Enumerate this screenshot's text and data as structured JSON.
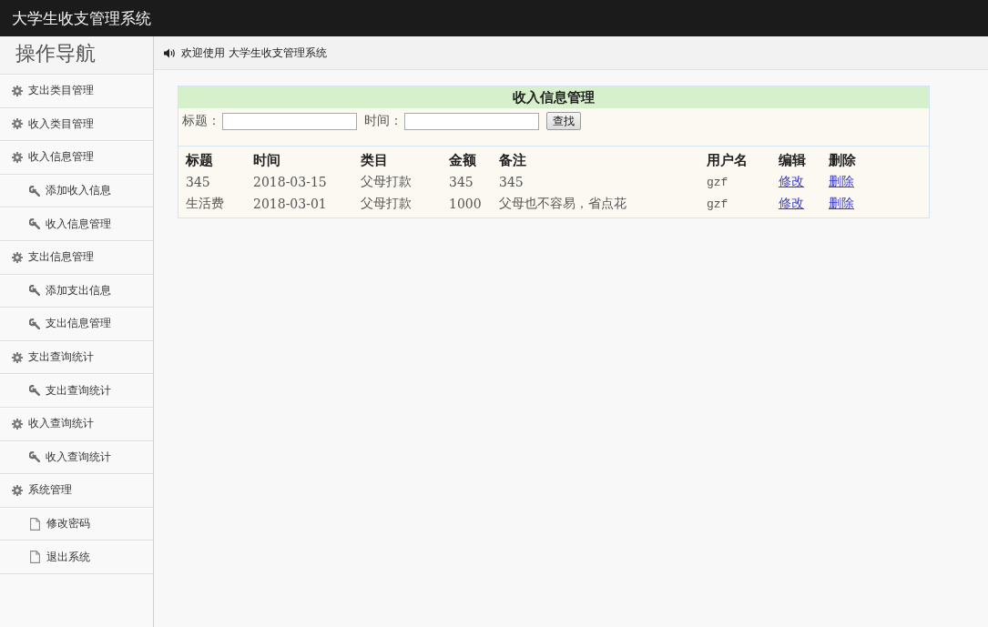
{
  "header": {
    "title": "大学生收支管理系统"
  },
  "sidebar": {
    "title": "操作导航",
    "items": [
      {
        "label": "支出类目管理"
      },
      {
        "label": "收入类目管理"
      },
      {
        "label": "收入信息管理",
        "children": [
          {
            "label": "添加收入信息",
            "kind": "wrench"
          },
          {
            "label": "收入信息管理",
            "kind": "wrench"
          }
        ]
      },
      {
        "label": "支出信息管理",
        "children": [
          {
            "label": "添加支出信息",
            "kind": "wrench"
          },
          {
            "label": "支出信息管理",
            "kind": "wrench"
          }
        ]
      },
      {
        "label": "支出查询统计",
        "children": [
          {
            "label": "支出查询统计",
            "kind": "wrench"
          }
        ]
      },
      {
        "label": "收入查询统计",
        "children": [
          {
            "label": "收入查询统计",
            "kind": "wrench"
          }
        ]
      },
      {
        "label": "系统管理",
        "children": [
          {
            "label": "修改密码",
            "kind": "page"
          },
          {
            "label": "退出系统",
            "kind": "page"
          }
        ]
      }
    ]
  },
  "welcome_bar": {
    "text": "欢迎使用 大学生收支管理系统"
  },
  "panel": {
    "title": "收入信息管理",
    "search": {
      "fields": [
        {
          "label": "标题："
        },
        {
          "label": "时间："
        }
      ],
      "button": "查找"
    },
    "table": {
      "columns": [
        "标题",
        "时间",
        "类目",
        "金额",
        "备注",
        "用户名",
        "编辑",
        "删除"
      ],
      "rows": [
        {
          "cells": [
            "345",
            "2018-03-15",
            "父母打款",
            "345",
            "345",
            "gzf"
          ],
          "edit": "修改",
          "delete": "删除"
        },
        {
          "cells": [
            "生活费",
            "2018-03-01",
            "父母打款",
            "1000",
            "父母也不容易，省点花",
            "gzf"
          ],
          "edit": "修改",
          "delete": "删除"
        }
      ]
    }
  }
}
